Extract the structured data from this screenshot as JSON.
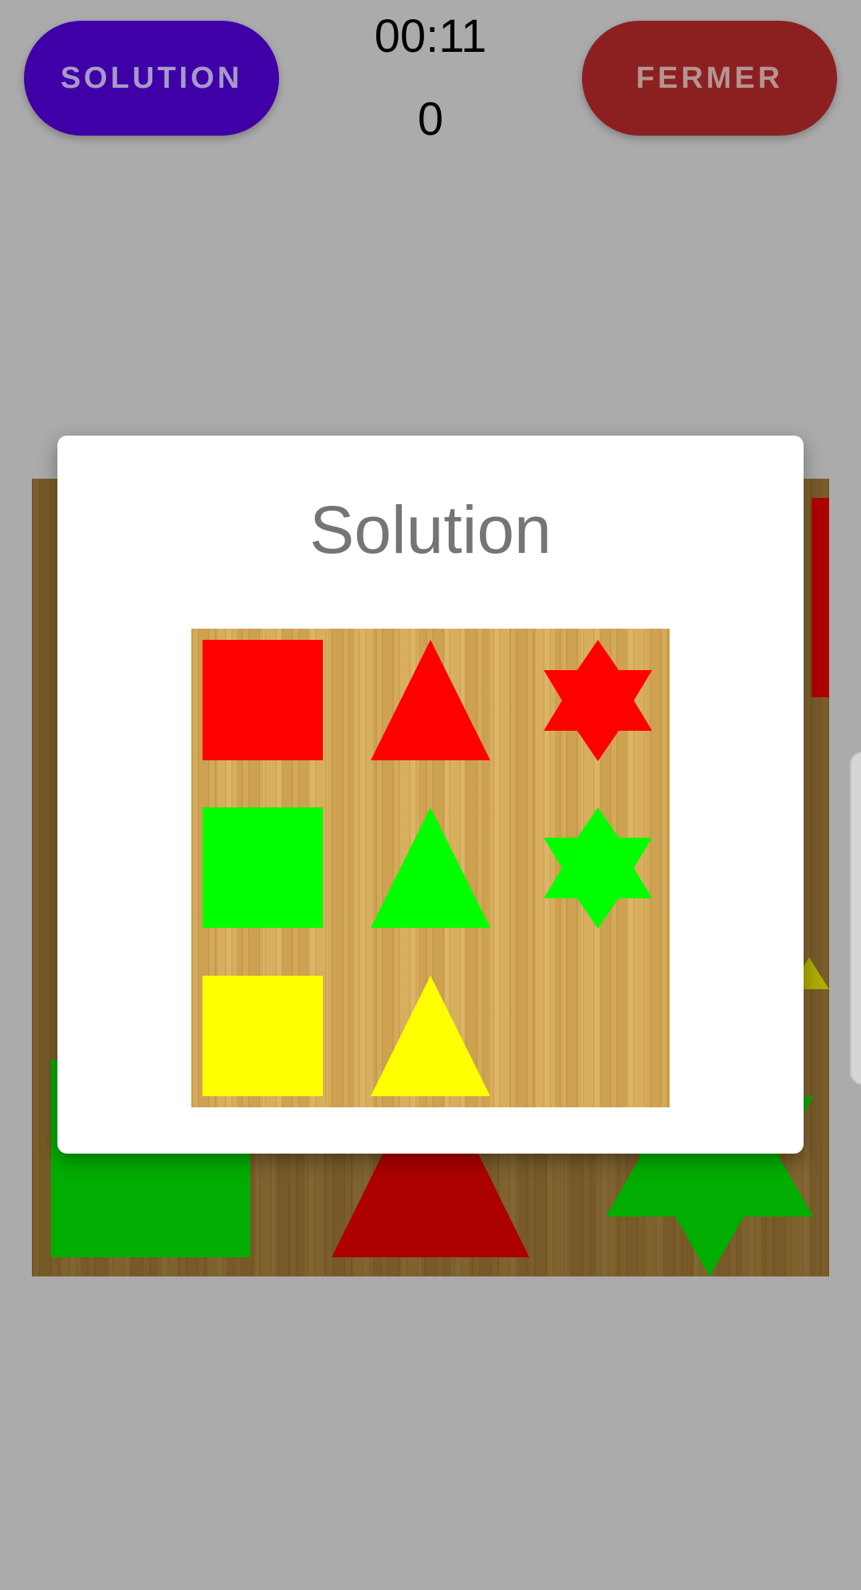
{
  "header": {
    "solution_button": "SOLUTION",
    "close_button": "FERMER",
    "timer": "00:11",
    "score": "0"
  },
  "dialog": {
    "title": "Solution"
  },
  "colors": {
    "background": "#ababab",
    "solution_button": "#3f00a8",
    "solution_button_text": "#a79ac7",
    "close_button": "#8c2020",
    "close_button_text": "#b69393",
    "red": "#ff0000",
    "green": "#00ff00",
    "yellow": "#ffff00"
  },
  "solution_grid": [
    [
      "red-square",
      "red-triangle",
      "red-star"
    ],
    [
      "green-square",
      "green-triangle",
      "green-star"
    ],
    [
      "yellow-square",
      "yellow-triangle",
      "empty"
    ]
  ]
}
